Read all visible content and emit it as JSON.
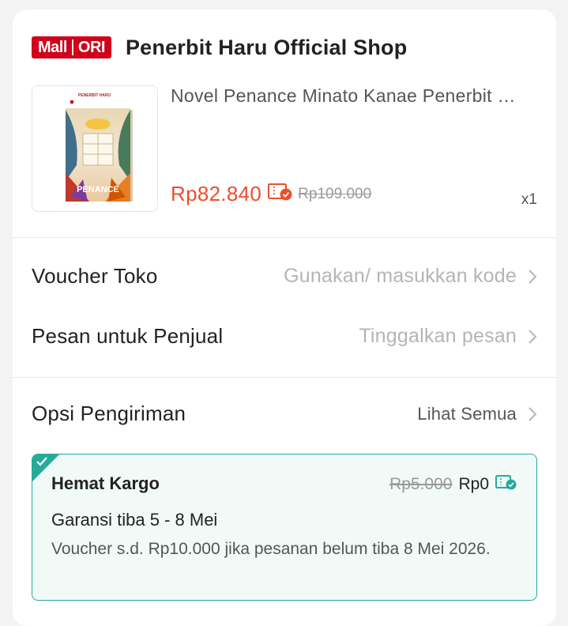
{
  "shop": {
    "badge_left": "Mall",
    "badge_right": "ORI",
    "name": "Penerbit Haru Official Shop"
  },
  "product": {
    "title": "Novel  Penance  Minato Kanae  Penerbit …",
    "cover_publisher": "PENERBIT HARU",
    "cover_title": "PENANCE",
    "price": "Rp82.840",
    "original_price": "Rp109.000",
    "quantity": "x1"
  },
  "voucher": {
    "label": "Voucher Toko",
    "value": "Gunakan/ masukkan kode"
  },
  "message": {
    "label": "Pesan untuk Penjual",
    "value": "Tinggalkan pesan"
  },
  "shipping": {
    "label": "Opsi Pengiriman",
    "link": "Lihat Semua",
    "option_name": "Hemat Kargo",
    "old_price": "Rp5.000",
    "new_price": "Rp0",
    "guarantee": "Garansi tiba 5 - 8 Mei",
    "note": "Voucher s.d.  Rp10.000 jika pesanan belum tiba 8 Mei 2026."
  },
  "colors": {
    "accent": "#ee4d2d",
    "mall_red": "#d0011b",
    "shipping_green": "#26aa99"
  },
  "icons": [
    "voucher-icon",
    "chevron-right-icon",
    "check-icon",
    "free-shipping-icon"
  ]
}
